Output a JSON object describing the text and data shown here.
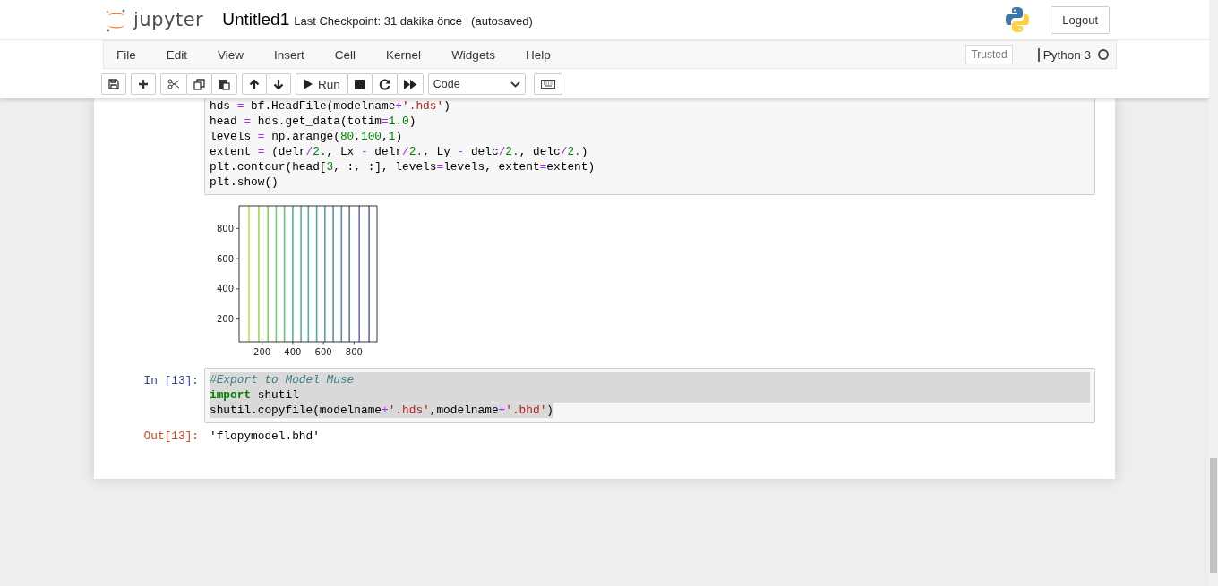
{
  "header": {
    "logo_text": "jupyter",
    "notebook_name": "Untitled1",
    "checkpoint": "Last Checkpoint: 31 dakika önce",
    "autosave": "(autosaved)",
    "logout": "Logout"
  },
  "menu": [
    "File",
    "Edit",
    "View",
    "Insert",
    "Cell",
    "Kernel",
    "Widgets",
    "Help"
  ],
  "trusted": "Trusted",
  "kernel": {
    "name": "Python 3",
    "busy": false
  },
  "toolbar": {
    "run_label": "Run",
    "cell_type": "Code"
  },
  "cells": [
    {
      "text_selected": false,
      "lines": [
        [
          {
            "kind": "n",
            "t": "hds "
          },
          {
            "kind": "o",
            "t": "="
          },
          {
            "kind": "n",
            "t": " bf.HeadFile(modelname"
          },
          {
            "kind": "o",
            "t": "+"
          },
          {
            "kind": "s",
            "t": "'.hds'"
          },
          {
            "kind": "n",
            "t": ")"
          }
        ],
        [
          {
            "kind": "n",
            "t": "head "
          },
          {
            "kind": "o",
            "t": "="
          },
          {
            "kind": "n",
            "t": " hds.get_data(totim"
          },
          {
            "kind": "o",
            "t": "="
          },
          {
            "kind": "m",
            "t": "1.0"
          },
          {
            "kind": "n",
            "t": ")"
          }
        ],
        [
          {
            "kind": "n",
            "t": "levels "
          },
          {
            "kind": "o",
            "t": "="
          },
          {
            "kind": "n",
            "t": " np.arange("
          },
          {
            "kind": "m",
            "t": "80"
          },
          {
            "kind": "n",
            "t": ","
          },
          {
            "kind": "m",
            "t": "100"
          },
          {
            "kind": "n",
            "t": ","
          },
          {
            "kind": "m",
            "t": "1"
          },
          {
            "kind": "n",
            "t": ")"
          }
        ],
        [
          {
            "kind": "n",
            "t": "extent "
          },
          {
            "kind": "o",
            "t": "="
          },
          {
            "kind": "n",
            "t": " (delr"
          },
          {
            "kind": "o",
            "t": "/"
          },
          {
            "kind": "m",
            "t": "2."
          },
          {
            "kind": "n",
            "t": ", Lx "
          },
          {
            "kind": "o",
            "t": "-"
          },
          {
            "kind": "n",
            "t": " delr"
          },
          {
            "kind": "o",
            "t": "/"
          },
          {
            "kind": "m",
            "t": "2."
          },
          {
            "kind": "n",
            "t": ", Ly "
          },
          {
            "kind": "o",
            "t": "-"
          },
          {
            "kind": "n",
            "t": " delc"
          },
          {
            "kind": "o",
            "t": "/"
          },
          {
            "kind": "m",
            "t": "2."
          },
          {
            "kind": "n",
            "t": ", delc"
          },
          {
            "kind": "o",
            "t": "/"
          },
          {
            "kind": "m",
            "t": "2."
          },
          {
            "kind": "n",
            "t": ")"
          }
        ],
        [
          {
            "kind": "n",
            "t": "plt.contour(head["
          },
          {
            "kind": "m",
            "t": "3"
          },
          {
            "kind": "n",
            "t": ", :, :], levels"
          },
          {
            "kind": "o",
            "t": "="
          },
          {
            "kind": "n",
            "t": "levels, extent"
          },
          {
            "kind": "o",
            "t": "="
          },
          {
            "kind": "n",
            "t": "extent)"
          }
        ],
        [
          {
            "kind": "n",
            "t": "plt.show()"
          }
        ]
      ],
      "output": {
        "kind": "plot",
        "chart_data": {
          "type": "line",
          "xlim": [
            50,
            950
          ],
          "ylim": [
            50,
            950
          ],
          "xticks": [
            200,
            400,
            600,
            800
          ],
          "yticks": [
            200,
            400,
            600,
            800
          ],
          "series": [
            {
              "color": "#c2df4f",
              "x": [
                114,
                114
              ],
              "values": [
                50,
                950
              ]
            },
            {
              "color": "#a4d95a",
              "x": [
                178,
                178
              ],
              "values": [
                50,
                950
              ]
            },
            {
              "color": "#8ad166",
              "x": [
                238,
                238
              ],
              "values": [
                50,
                950
              ]
            },
            {
              "color": "#73c872",
              "x": [
                292,
                292
              ],
              "values": [
                50,
                950
              ]
            },
            {
              "color": "#64bf80",
              "x": [
                346,
                346
              ],
              "values": [
                50,
                950
              ]
            },
            {
              "color": "#5bb78c",
              "x": [
                400,
                400
              ],
              "values": [
                50,
                950
              ]
            },
            {
              "color": "#56b198",
              "x": [
                454,
                454
              ],
              "values": [
                50,
                950
              ]
            },
            {
              "color": "#55ac9f",
              "x": [
                502,
                502
              ],
              "values": [
                50,
                950
              ]
            },
            {
              "color": "#56a6a3",
              "x": [
                556,
                556
              ],
              "values": [
                50,
                950
              ]
            },
            {
              "color": "#589ea5",
              "x": [
                610,
                610
              ],
              "values": [
                50,
                950
              ]
            },
            {
              "color": "#5b95a6",
              "x": [
                664,
                664
              ],
              "values": [
                50,
                950
              ]
            },
            {
              "color": "#5e8ba8",
              "x": [
                718,
                718
              ],
              "values": [
                50,
                950
              ]
            },
            {
              "color": "#6380a9",
              "x": [
                770,
                770
              ],
              "values": [
                50,
                950
              ]
            },
            {
              "color": "#6875aa",
              "x": [
                834,
                834
              ],
              "values": [
                50,
                950
              ]
            },
            {
              "color": "#6c6aa8",
              "x": [
                898,
                898
              ],
              "values": [
                50,
                950
              ]
            }
          ]
        }
      }
    },
    {
      "prompt": "In [13]:",
      "text_selected": true,
      "lines": [
        [
          {
            "kind": "c",
            "t": "#Export to Model Muse"
          }
        ],
        [
          {
            "kind": "k",
            "t": "import"
          },
          {
            "kind": "n",
            "t": " shutil"
          }
        ],
        [
          {
            "kind": "n",
            "t": "shutil.copyfile(modelname"
          },
          {
            "kind": "o",
            "t": "+"
          },
          {
            "kind": "s",
            "t": "'.hds'"
          },
          {
            "kind": "n",
            "t": ",modelname"
          },
          {
            "kind": "o",
            "t": "+"
          },
          {
            "kind": "s",
            "t": "'.bhd'"
          },
          {
            "kind": "n",
            "t": ")"
          }
        ]
      ],
      "output": {
        "kind": "text",
        "prompt": "Out[13]:",
        "text": "'flopymodel.bhd'"
      }
    }
  ]
}
